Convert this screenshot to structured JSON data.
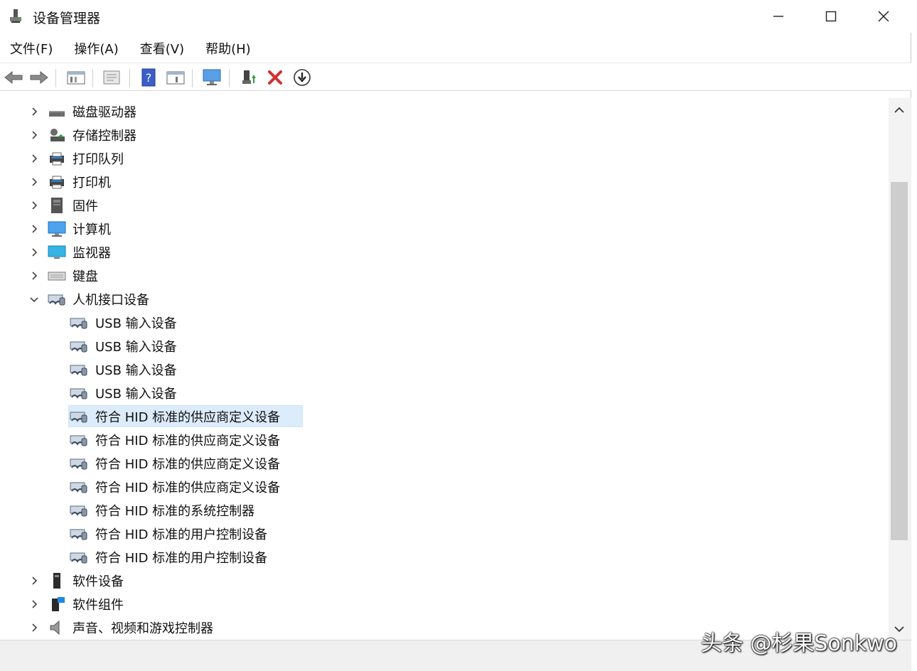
{
  "window": {
    "title": "设备管理器",
    "controls": {
      "minimize": "—",
      "maximize": "☐",
      "close": "✕"
    }
  },
  "menu": [
    {
      "label": "文件(F)"
    },
    {
      "label": "操作(A)"
    },
    {
      "label": "查看(V)"
    },
    {
      "label": "帮助(H)"
    }
  ],
  "toolbar": {
    "buttons": [
      "back-arrow-icon",
      "forward-arrow-icon",
      "properties-icon",
      "view-icon",
      "help-icon",
      "details-icon",
      "monitor-scan-icon",
      "update-driver-icon",
      "uninstall-icon",
      "download-icon"
    ]
  },
  "tree": [
    {
      "label": "磁盘驱动器",
      "level": 0,
      "expanded": false,
      "icon": "disk-drive-icon"
    },
    {
      "label": "存储控制器",
      "level": 0,
      "expanded": false,
      "icon": "storage-controller-icon"
    },
    {
      "label": "打印队列",
      "level": 0,
      "expanded": false,
      "icon": "print-queue-icon"
    },
    {
      "label": "打印机",
      "level": 0,
      "expanded": false,
      "icon": "printer-icon"
    },
    {
      "label": "固件",
      "level": 0,
      "expanded": false,
      "icon": "firmware-icon"
    },
    {
      "label": "计算机",
      "level": 0,
      "expanded": false,
      "icon": "computer-icon"
    },
    {
      "label": "监视器",
      "level": 0,
      "expanded": false,
      "icon": "monitor-icon"
    },
    {
      "label": "键盘",
      "level": 0,
      "expanded": false,
      "icon": "keyboard-icon"
    },
    {
      "label": "人机接口设备",
      "level": 0,
      "expanded": true,
      "icon": "hid-icon"
    },
    {
      "label": "USB 输入设备",
      "level": 1,
      "icon": "hid-icon"
    },
    {
      "label": "USB 输入设备",
      "level": 1,
      "icon": "hid-icon"
    },
    {
      "label": "USB 输入设备",
      "level": 1,
      "icon": "hid-icon"
    },
    {
      "label": "USB 输入设备",
      "level": 1,
      "icon": "hid-icon"
    },
    {
      "label": "符合 HID 标准的供应商定义设备",
      "level": 1,
      "icon": "hid-icon",
      "selected": true
    },
    {
      "label": "符合 HID 标准的供应商定义设备",
      "level": 1,
      "icon": "hid-icon"
    },
    {
      "label": "符合 HID 标准的供应商定义设备",
      "level": 1,
      "icon": "hid-icon"
    },
    {
      "label": "符合 HID 标准的供应商定义设备",
      "level": 1,
      "icon": "hid-icon"
    },
    {
      "label": "符合 HID 标准的系统控制器",
      "level": 1,
      "icon": "hid-icon"
    },
    {
      "label": "符合 HID 标准的用户控制设备",
      "level": 1,
      "icon": "hid-icon"
    },
    {
      "label": "符合 HID 标准的用户控制设备",
      "level": 1,
      "icon": "hid-icon"
    },
    {
      "label": "软件设备",
      "level": 0,
      "expanded": false,
      "icon": "software-device-icon"
    },
    {
      "label": "软件组件",
      "level": 0,
      "expanded": false,
      "icon": "software-component-icon"
    },
    {
      "label": "声音、视频和游戏控制器",
      "level": 0,
      "expanded": false,
      "icon": "sound-icon"
    }
  ],
  "watermark": "头条 @杉果Sonkwo",
  "colors": {
    "selection": "#dcecfb",
    "accent": "#1e88e5",
    "delete_red": "#d32f2f"
  }
}
